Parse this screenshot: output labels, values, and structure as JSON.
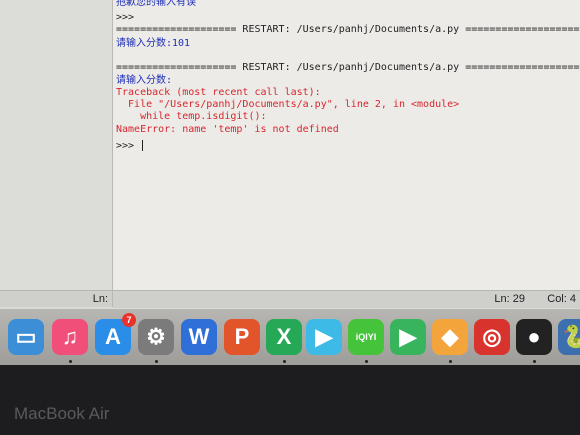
{
  "shell": {
    "lines": [
      {
        "text": "抱歉您的输入有误",
        "color": "blue"
      },
      {
        "text": ">>> "
      },
      {
        "text": "==================== RESTART: /Users/panhj/Documents/a.py ===================="
      },
      {
        "text": "请输入分数:101",
        "color": "blue"
      },
      {
        "text": ""
      },
      {
        "text": "==================== RESTART: /Users/panhj/Documents/a.py ===================="
      },
      {
        "text": "请输入分数:",
        "color": "blue"
      },
      {
        "text": "Traceback (most recent call last):",
        "color": "red"
      },
      {
        "text": "  File \"/Users/panhj/Documents/a.py\", line 2, in <module>",
        "color": "red"
      },
      {
        "text": "    while temp.isdigit():",
        "color": "red"
      },
      {
        "text": "NameError: name 'temp' is not defined",
        "color": "red"
      },
      {
        "text": ">>> "
      }
    ]
  },
  "status": {
    "left_ln": "Ln:",
    "ln": "Ln: 29",
    "col": "Col: 4"
  },
  "dock": {
    "appstore_badge": "7",
    "icons": [
      {
        "name": "presentation-icon",
        "glyph": "▭",
        "color": "#3c8fd7"
      },
      {
        "name": "itunes-icon",
        "glyph": "♫",
        "color": "#f04f7a"
      },
      {
        "name": "app-store-icon",
        "glyph": "A",
        "color": "#2a8ee8"
      },
      {
        "name": "system-preferences-icon",
        "glyph": "⚙",
        "color": "#7b7b7b"
      },
      {
        "name": "wps-writer-icon",
        "glyph": "W",
        "color": "#2f6fd8"
      },
      {
        "name": "wps-presentation-icon",
        "glyph": "P",
        "color": "#e2552b"
      },
      {
        "name": "wps-spreadsheet-icon",
        "glyph": "X",
        "color": "#25a956"
      },
      {
        "name": "media-player-icon",
        "glyph": "▶",
        "color": "#3dbbe6"
      },
      {
        "name": "iqiyi-icon",
        "glyph": "iQIYI",
        "color": "#44c33b"
      },
      {
        "name": "video-play-icon",
        "glyph": "▶",
        "color": "#38b45c"
      },
      {
        "name": "cube-app-icon",
        "glyph": "◆",
        "color": "#f3a43a"
      },
      {
        "name": "netease-music-icon",
        "glyph": "◎",
        "color": "#d8332c"
      },
      {
        "name": "qq-penguin-icon",
        "glyph": "●",
        "color": "#222222"
      },
      {
        "name": "python-icon",
        "glyph": "🐍",
        "color": "#3b6fae"
      }
    ]
  },
  "hardware": {
    "brand": "MacBook Air"
  }
}
